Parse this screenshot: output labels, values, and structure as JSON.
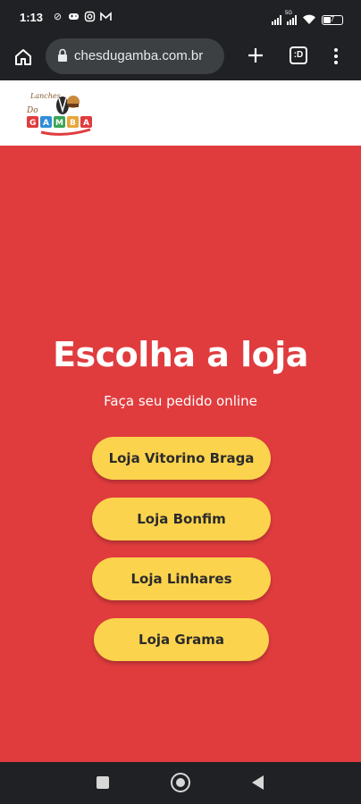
{
  "status_bar": {
    "time": "1:13",
    "battery_level": "7",
    "network": "5G",
    "icons_left": [
      "do-not-disturb-icon",
      "game-controller-icon",
      "instagram-icon",
      "gmail-icon"
    ],
    "icons_right": [
      "signal-icon",
      "signal-5g-icon",
      "wifi-icon",
      "battery-icon"
    ]
  },
  "browser": {
    "url": "chesdugamba.com.br",
    "tab_count": ":D"
  },
  "site": {
    "logo_text": "Lanches Do GAMBA"
  },
  "hero": {
    "title": "Escolha a loja",
    "subtitle": "Faça seu pedido online",
    "background_color": "#e03c3e",
    "button_color": "#fcd34d",
    "stores": [
      {
        "label": "Loja Vitorino Braga"
      },
      {
        "label": "Loja Bonfim"
      },
      {
        "label": "Loja Linhares"
      },
      {
        "label": "Loja Grama"
      }
    ]
  },
  "nav": {
    "buttons": [
      "recent-apps-icon",
      "home-icon",
      "back-icon"
    ]
  }
}
